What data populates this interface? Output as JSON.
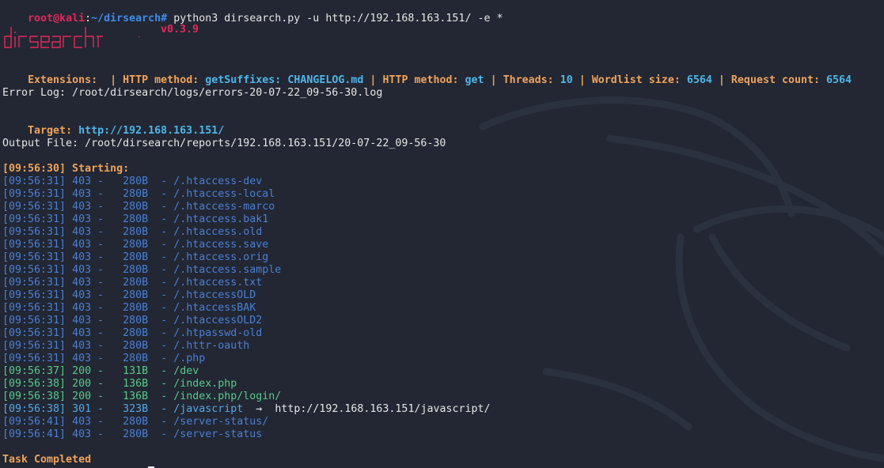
{
  "prompt": {
    "user_host": "root@kali",
    "colon": ":",
    "path": "~/dirsearch",
    "symbol": "#",
    "command": " python3 dirsearch.py -u http://192.168.163.151/ -e *"
  },
  "banner": {
    "logo_text": "dirsearch",
    "version": "v0.3.9"
  },
  "info": {
    "ext_label": "Extensions:",
    "ext_value": "",
    "method_label_1": "HTTP method:",
    "method_value_1": "getSuffixes:",
    "changelog": "CHANGELOG.md",
    "method_label_2": "HTTP method:",
    "method_value_2": "get",
    "threads_label": "Threads:",
    "threads_value": "10",
    "wordlist_label": "Wordlist size:",
    "wordlist_value": "6564",
    "request_label": "Request count:",
    "request_value": "6564",
    "separator": "|"
  },
  "error_log": "Error Log: /root/dirsearch/logs/errors-20-07-22_09-56-30.log",
  "target": {
    "label": "Target:",
    "url": "http://192.168.163.151/"
  },
  "output_file": "Output File: /root/dirsearch/reports/192.168.163.151/20-07-22_09-56-30",
  "starting": "[09:56:30] Starting:",
  "results": [
    {
      "time": "[09:56:31]",
      "status": "403",
      "size": "280B",
      "path": "/.htaccess-dev",
      "redirect": ""
    },
    {
      "time": "[09:56:31]",
      "status": "403",
      "size": "280B",
      "path": "/.htaccess-local",
      "redirect": ""
    },
    {
      "time": "[09:56:31]",
      "status": "403",
      "size": "280B",
      "path": "/.htaccess-marco",
      "redirect": ""
    },
    {
      "time": "[09:56:31]",
      "status": "403",
      "size": "280B",
      "path": "/.htaccess.bak1",
      "redirect": ""
    },
    {
      "time": "[09:56:31]",
      "status": "403",
      "size": "280B",
      "path": "/.htaccess.old",
      "redirect": ""
    },
    {
      "time": "[09:56:31]",
      "status": "403",
      "size": "280B",
      "path": "/.htaccess.save",
      "redirect": ""
    },
    {
      "time": "[09:56:31]",
      "status": "403",
      "size": "280B",
      "path": "/.htaccess.orig",
      "redirect": ""
    },
    {
      "time": "[09:56:31]",
      "status": "403",
      "size": "280B",
      "path": "/.htaccess.sample",
      "redirect": ""
    },
    {
      "time": "[09:56:31]",
      "status": "403",
      "size": "280B",
      "path": "/.htaccess.txt",
      "redirect": ""
    },
    {
      "time": "[09:56:31]",
      "status": "403",
      "size": "280B",
      "path": "/.htaccessOLD",
      "redirect": ""
    },
    {
      "time": "[09:56:31]",
      "status": "403",
      "size": "280B",
      "path": "/.htaccessBAK",
      "redirect": ""
    },
    {
      "time": "[09:56:31]",
      "status": "403",
      "size": "280B",
      "path": "/.htaccessOLD2",
      "redirect": ""
    },
    {
      "time": "[09:56:31]",
      "status": "403",
      "size": "280B",
      "path": "/.htpasswd-old",
      "redirect": ""
    },
    {
      "time": "[09:56:31]",
      "status": "403",
      "size": "280B",
      "path": "/.httr-oauth",
      "redirect": ""
    },
    {
      "time": "[09:56:31]",
      "status": "403",
      "size": "280B",
      "path": "/.php",
      "redirect": ""
    },
    {
      "time": "[09:56:37]",
      "status": "200",
      "size": "131B",
      "path": "/dev",
      "redirect": ""
    },
    {
      "time": "[09:56:38]",
      "status": "200",
      "size": "136B",
      "path": "/index.php",
      "redirect": ""
    },
    {
      "time": "[09:56:38]",
      "status": "200",
      "size": "136B",
      "path": "/index.php/login/",
      "redirect": ""
    },
    {
      "time": "[09:56:38]",
      "status": "301",
      "size": "323B",
      "path": "/javascript",
      "redirect": "http://192.168.163.151/javascript/"
    },
    {
      "time": "[09:56:41]",
      "status": "403",
      "size": "280B",
      "path": "/server-status/",
      "redirect": ""
    },
    {
      "time": "[09:56:41]",
      "status": "403",
      "size": "280B",
      "path": "/server-status",
      "redirect": ""
    }
  ],
  "arrow": "→",
  "task_completed": "Task Completed",
  "colors": {
    "background": "#222733",
    "prompt_red": "#e3285a",
    "prompt_blue": "#3f8be8",
    "label_orange": "#f0a35a",
    "value_cyan": "#4fb6e9",
    "status_403": "#4a7fd4",
    "status_200": "#58c98a",
    "status_301": "#53a8e8"
  }
}
